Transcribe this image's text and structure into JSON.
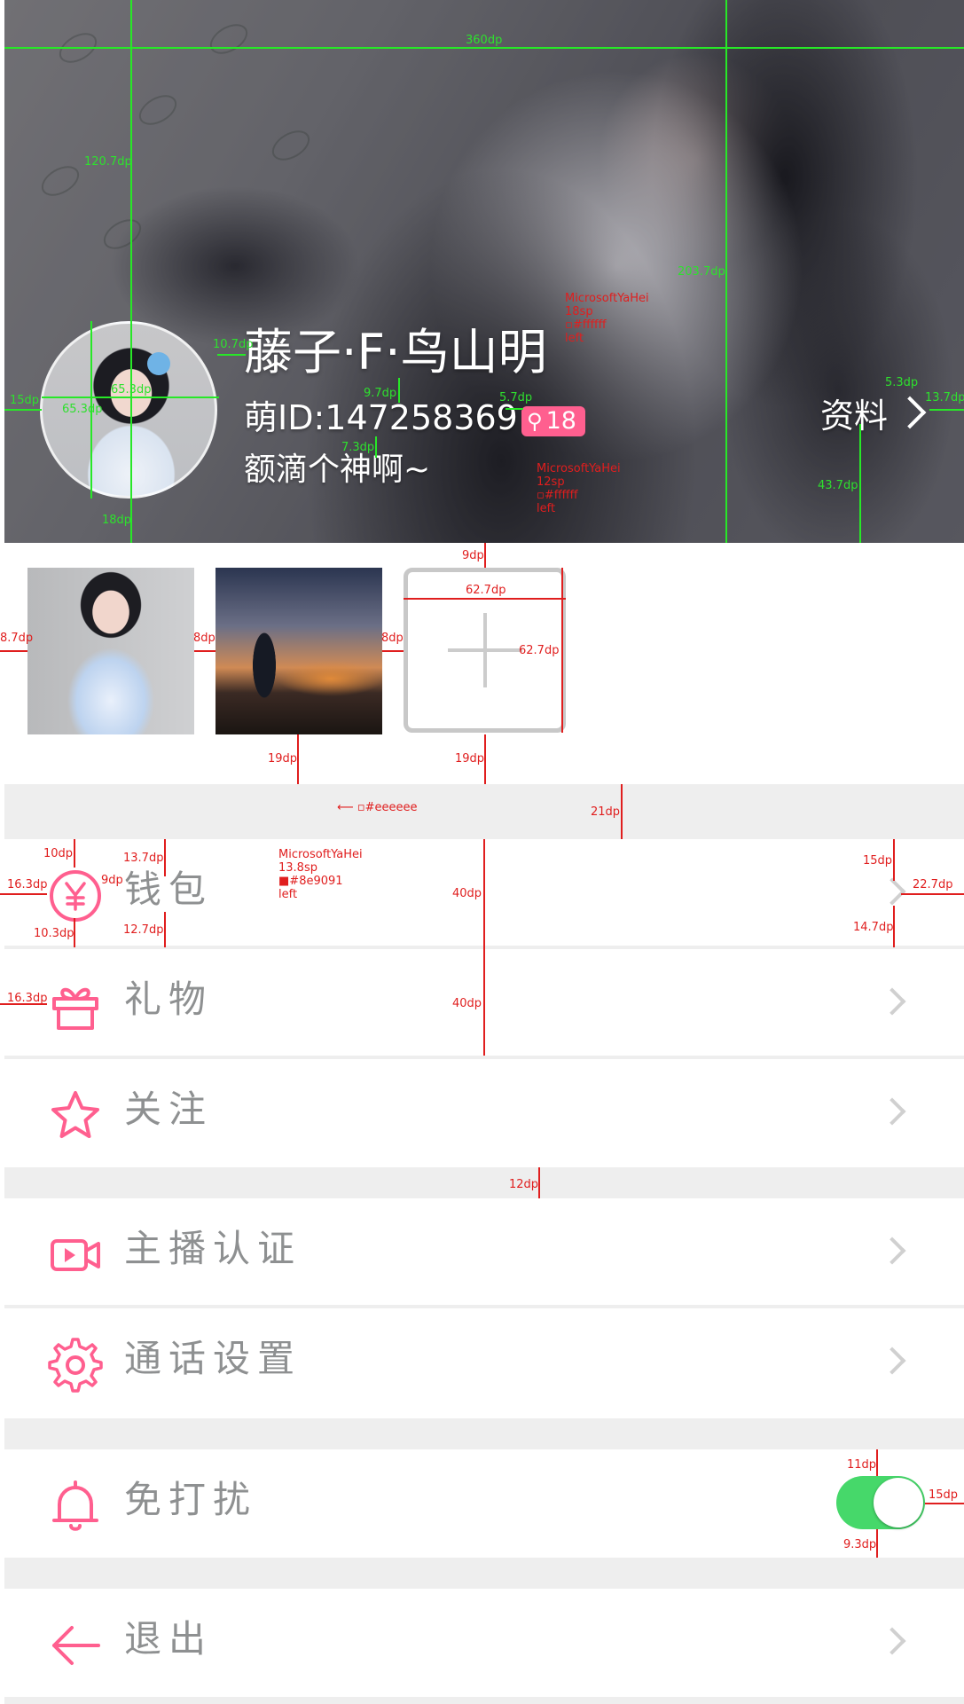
{
  "profile": {
    "name": "藤子·F·鸟山明",
    "id_text": "萌ID:147258369",
    "badge_count": "18",
    "signature": "额滴个神啊~",
    "profile_link": "资料"
  },
  "annotations": {
    "green": {
      "width": "360dp",
      "top_gap": "120.7dp",
      "avatar_to_name": "10.7dp",
      "left_margin": "15dp",
      "avatar_size_a": "65.3dp",
      "avatar_size_b": "65.3dp",
      "avatar_bottom": "18dp",
      "name_to_id": "9.7dp",
      "id_to_badge": "5.7dp",
      "id_to_signature": "7.3dp",
      "banner_height": "203.7dp",
      "link_gap": "5.3dp",
      "right_margin": "13.7dp",
      "link_bottom": "43.7dp"
    },
    "red": {
      "name_font_name": "MicrosoftYaHei",
      "name_font_size": "18sp",
      "name_color": "#ffffff",
      "name_align": "left",
      "id_font_name": "MicrosoftYaHei",
      "id_font_size": "12sp",
      "id_color": "#ffffff",
      "id_align": "left",
      "photos_top": "9dp",
      "add_width": "62.7dp",
      "add_height": "62.7dp",
      "photo_left": "8.7dp",
      "photo_gap_1": "8dp",
      "photo_gap_2": "8dp",
      "photo_bottom_1": "19dp",
      "photo_bottom_2": "19dp",
      "sep_color": "#eeeeee",
      "sep_height": "21dp",
      "icon_top": "10dp",
      "icon_left": "16.3dp",
      "icon_to_label": "9dp",
      "icon_bottom": "10.3dp",
      "label_top": "13.7dp",
      "label_bottom": "12.7dp",
      "label_font_name": "MicrosoftYaHei",
      "label_font_size": "13.8sp",
      "label_color": "#8e9091",
      "label_align": "left",
      "row_height_1": "40dp",
      "chev_top": "15dp",
      "chev_right": "22.7dp",
      "chev_bottom": "14.7dp",
      "icon_left_2": "16.3dp",
      "row_height_2": "40dp",
      "group_gap": "12dp",
      "toggle_top": "11dp",
      "toggle_right": "15dp",
      "toggle_bottom": "9.3dp"
    }
  },
  "menu": [
    {
      "label": "钱包",
      "icon": "yen-circle-icon"
    },
    {
      "label": "礼物",
      "icon": "gift-icon"
    },
    {
      "label": "关注",
      "icon": "star-icon"
    },
    {
      "label": "主播认证",
      "icon": "video-camera-icon"
    },
    {
      "label": "通话设置",
      "icon": "gear-icon"
    },
    {
      "label": "免打扰",
      "icon": "bell-icon"
    },
    {
      "label": "退出",
      "icon": "arrow-left-icon"
    }
  ],
  "dnd_toggle": {
    "on": true
  },
  "colors": {
    "accent": "#ff5f8f",
    "label": "#8e9091",
    "separator": "#eeeeee",
    "toggle_on": "#46d86a",
    "banner_text": "#ffffff"
  }
}
